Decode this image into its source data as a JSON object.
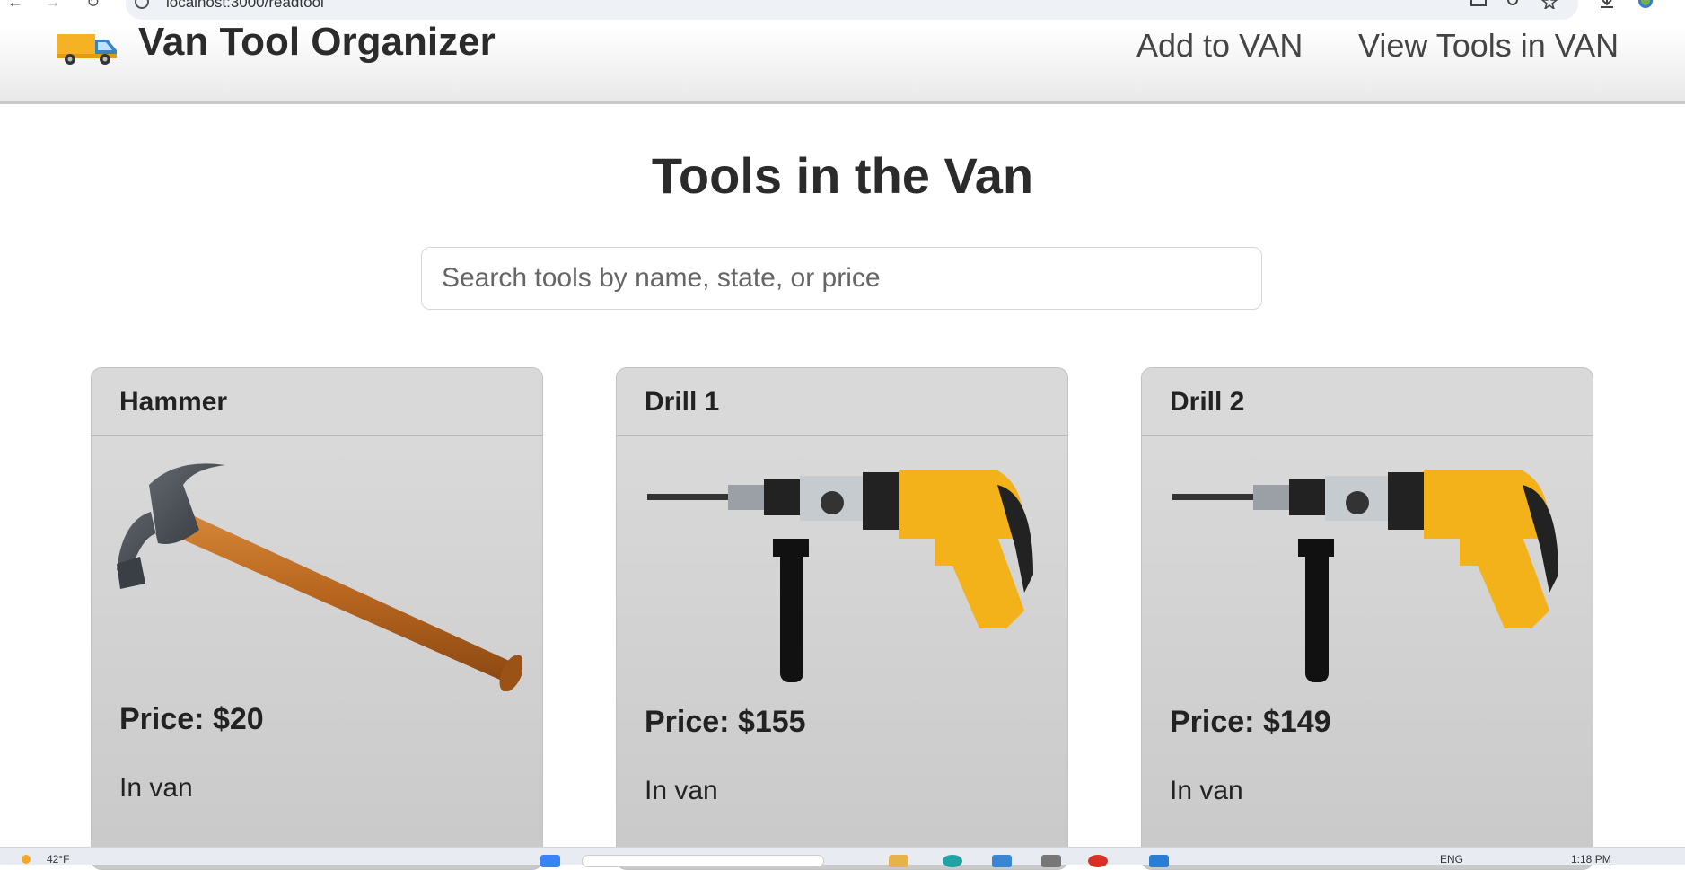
{
  "browser": {
    "url": "localhost:3000/readtool"
  },
  "header": {
    "title": "Van Tool Organizer",
    "nav": [
      {
        "label": "Add to VAN"
      },
      {
        "label": "View Tools in VAN"
      }
    ]
  },
  "main": {
    "title": "Tools in the Van",
    "search": {
      "placeholder": "Search tools by name, state, or price",
      "value": ""
    },
    "cards": [
      {
        "name": "Hammer",
        "price": "Price: $20",
        "status": "In van",
        "image": "hammer"
      },
      {
        "name": "Drill 1",
        "price": "Price: $155",
        "status": "In van",
        "image": "drill"
      },
      {
        "name": "Drill 2",
        "price": "Price: $149",
        "status": "In van",
        "image": "drill"
      }
    ]
  },
  "taskbar": {
    "weather": "42°F",
    "language": "ENG",
    "time": "1:18 PM"
  },
  "colors": {
    "drill_body": "#f3b21a",
    "hammer_handle": "#c9772a",
    "header_border": "#c9c9c9"
  }
}
